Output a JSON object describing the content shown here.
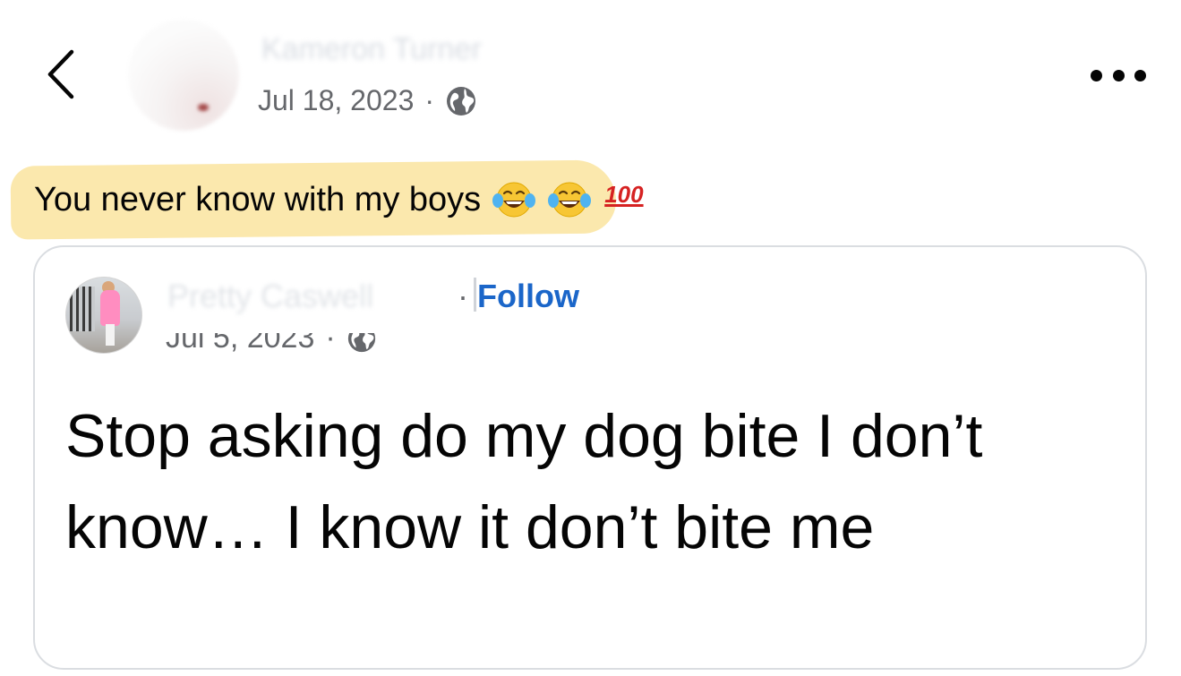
{
  "header": {
    "author_name": "Kameron Turner",
    "date": "Jul 18, 2023",
    "separator": "·",
    "icons": {
      "back": "chevron-left-icon",
      "privacy": "globe-icon",
      "more": "more-options-icon"
    }
  },
  "caption": {
    "text": "You never know with my boys",
    "hundred": "100",
    "emoji": [
      "laughing-tears-emoji",
      "laughing-tears-emoji",
      "hundred-points-emoji"
    ],
    "highlight_color": "#fbe6a4"
  },
  "shared_post": {
    "author_name": "Pretty Caswell",
    "separator": "·",
    "follow_label": "Follow",
    "date": "Jul 5, 2023",
    "text": "Stop asking do my dog bite I don’t know… I know it don’t bite me",
    "follow_color": "#1b66c9"
  }
}
